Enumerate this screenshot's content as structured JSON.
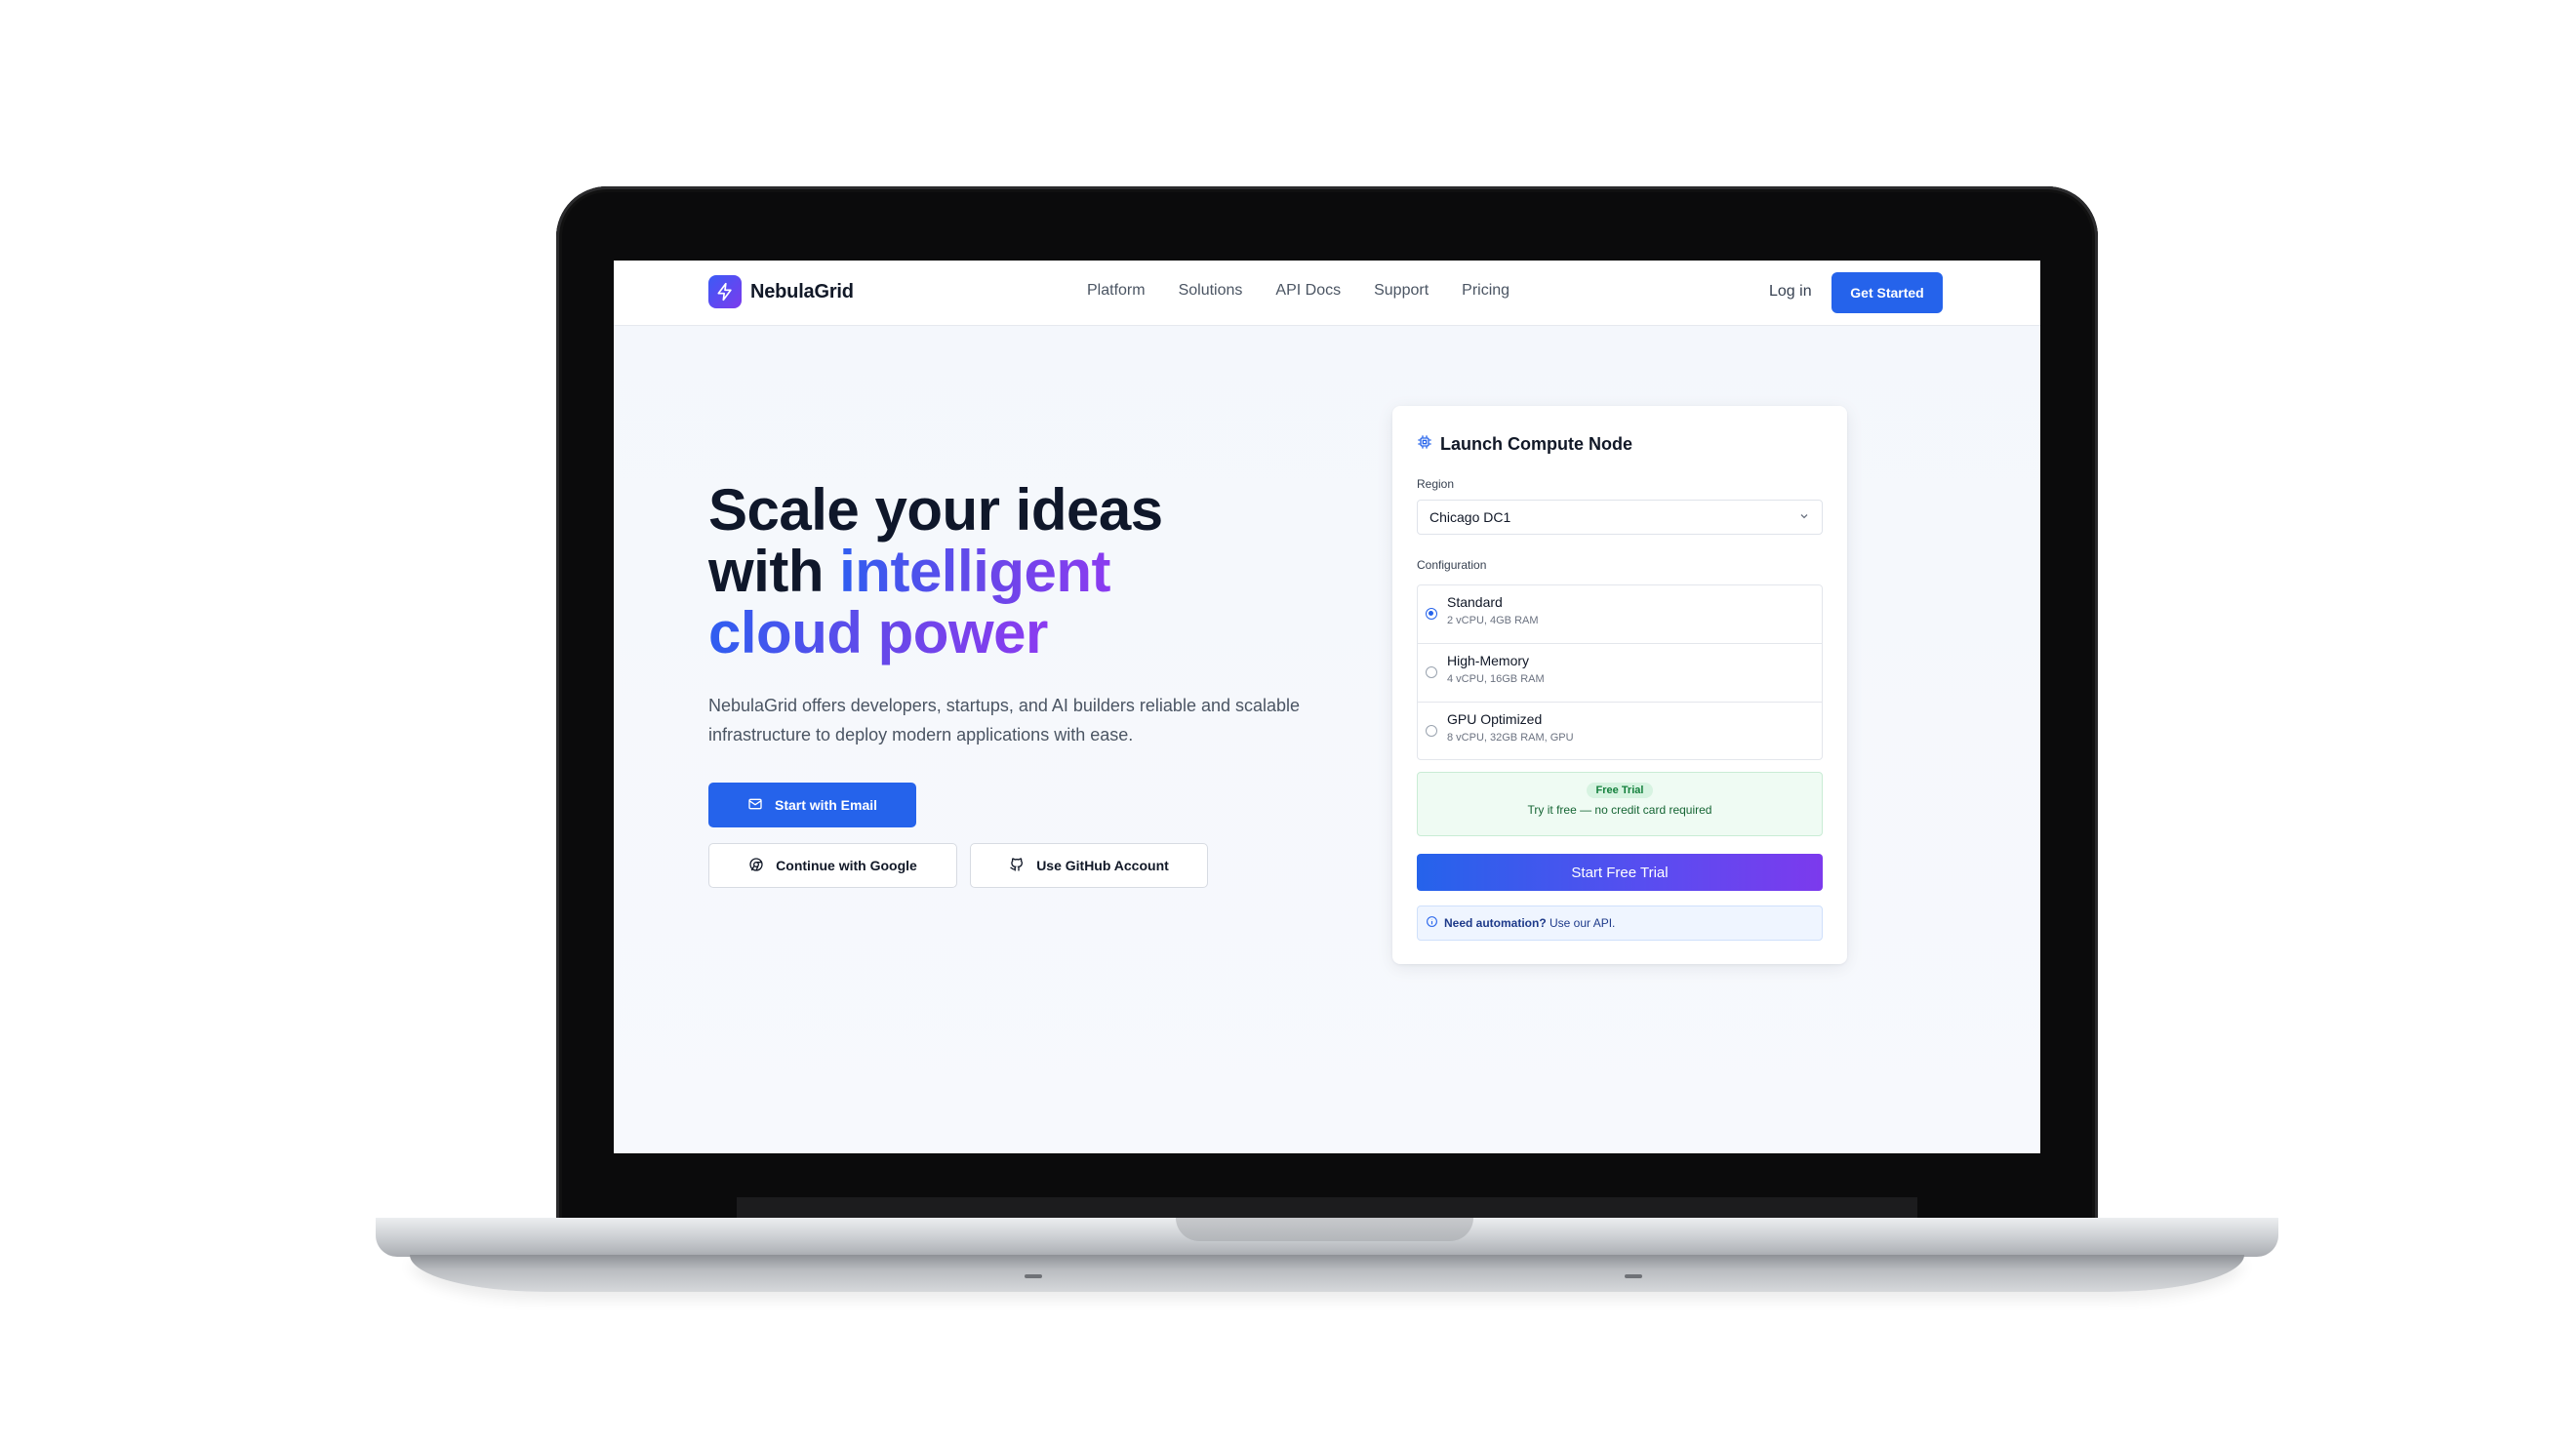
{
  "brand": {
    "name": "NebulaGrid"
  },
  "nav": {
    "links": [
      "Platform",
      "Solutions",
      "API Docs",
      "Support",
      "Pricing"
    ],
    "login": "Log in",
    "cta": "Get Started"
  },
  "hero": {
    "line1": "Scale your ideas",
    "line2_plain": "with ",
    "line2_accent": "intelligent",
    "line3_accent": "cloud power",
    "description": "NebulaGrid offers developers, startups, and AI builders reliable and scalable infrastructure to deploy modern applications with ease.",
    "buttons": {
      "email": "Start with Email",
      "google": "Continue with Google",
      "github": "Use GitHub Account"
    }
  },
  "card": {
    "title": "Launch Compute Node",
    "region_label": "Region",
    "region_value": "Chicago DC1",
    "config_label": "Configuration",
    "options": [
      {
        "name": "Standard",
        "spec": "2 vCPU, 4GB RAM",
        "selected": true
      },
      {
        "name": "High-Memory",
        "spec": "4 vCPU, 16GB RAM",
        "selected": false
      },
      {
        "name": "GPU Optimized",
        "spec": "8 vCPU, 32GB RAM, GPU",
        "selected": false
      }
    ],
    "trial_badge": "Free Trial",
    "trial_text": "Try it free — no credit card required",
    "start_button": "Start Free Trial",
    "api_note_bold": "Need automation?",
    "api_note_rest": " Use our API."
  },
  "colors": {
    "primary": "#2563eb",
    "gradient_start": "#2f5ef0",
    "gradient_end": "#8b3bf0",
    "trial_bg": "#effbf3"
  }
}
